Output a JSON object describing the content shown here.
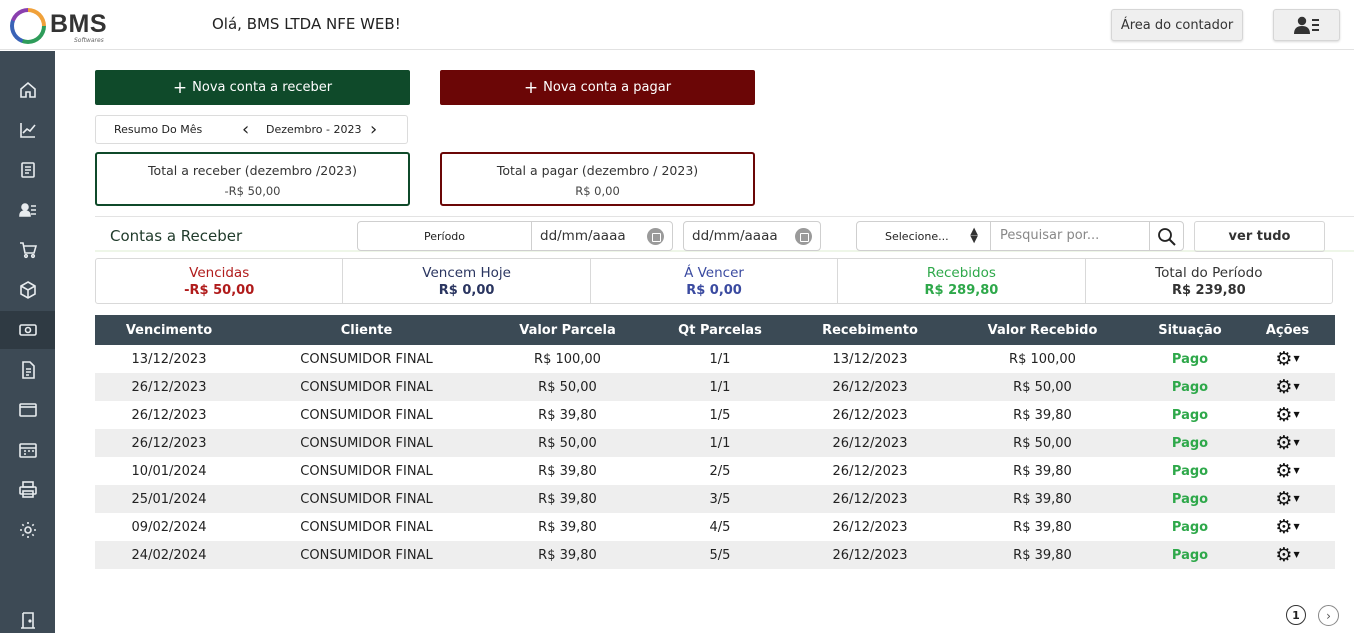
{
  "header": {
    "logo_text": "BMS",
    "logo_sub": "Softwares",
    "greeting": "Olá, BMS LTDA NFE WEB!",
    "contador_label": "Área do contador"
  },
  "sidebar": {
    "items": [
      {
        "icon": "home-icon"
      },
      {
        "icon": "chart-line-icon"
      },
      {
        "icon": "document-icon"
      },
      {
        "icon": "user-list-icon"
      },
      {
        "icon": "cart-icon"
      },
      {
        "icon": "box-icon"
      },
      {
        "icon": "money-icon",
        "active": true
      },
      {
        "icon": "invoice-icon"
      },
      {
        "icon": "window-icon"
      },
      {
        "icon": "calendar-icon"
      },
      {
        "icon": "printer-icon"
      },
      {
        "icon": "gear-icon"
      },
      {
        "icon": "exit-door-icon"
      }
    ]
  },
  "actions": {
    "receber_label": "Nova conta a receber",
    "pagar_label": "Nova conta a pagar"
  },
  "month_nav": {
    "label": "Resumo Do Mês",
    "current": "Dezembro - 2023"
  },
  "totals": {
    "receber_title": "Total a receber (dezembro /2023)",
    "receber_value": "-R$ 50,00",
    "pagar_title": "Total a pagar (dezembro / 2023)",
    "pagar_value": "R$ 0,00"
  },
  "filters": {
    "section_title": "Contas a Receber",
    "periodo_label": "Período",
    "date_from": "dd/mm/aaaa",
    "date_to": "dd/mm/aaaa",
    "select_value": "Selecione...",
    "search_placeholder": "Pesquisar por...",
    "ver_tudo_label": "ver tudo"
  },
  "summary": [
    {
      "label": "Vencidas",
      "value": "-R$ 50,00",
      "label_color": "#b01b1b",
      "value_color": "#b01b1b"
    },
    {
      "label": "Vencem Hoje",
      "value": "R$ 0,00",
      "label_color": "#2a3560",
      "value_color": "#2a3560"
    },
    {
      "label": "Á Vencer",
      "value": "R$ 0,00",
      "label_color": "#3a4aa0",
      "value_color": "#3a4aa0"
    },
    {
      "label": "Recebidos",
      "value": "R$ 289,80",
      "label_color": "#2ea84a",
      "value_color": "#2ea84a"
    },
    {
      "label": "Total do Período",
      "value": "R$ 239,80",
      "label_color": "#333333",
      "value_color": "#333333"
    }
  ],
  "table": {
    "columns": [
      "Vencimento",
      "Cliente",
      "Valor Parcela",
      "Qt Parcelas",
      "Recebimento",
      "Valor Recebido",
      "Situação",
      "Ações"
    ],
    "rows": [
      [
        "13/12/2023",
        "CONSUMIDOR FINAL",
        "R$ 100,00",
        "1/1",
        "13/12/2023",
        "R$ 100,00",
        "Pago"
      ],
      [
        "26/12/2023",
        "CONSUMIDOR FINAL",
        "R$ 50,00",
        "1/1",
        "26/12/2023",
        "R$ 50,00",
        "Pago"
      ],
      [
        "26/12/2023",
        "CONSUMIDOR FINAL",
        "R$ 39,80",
        "1/5",
        "26/12/2023",
        "R$ 39,80",
        "Pago"
      ],
      [
        "26/12/2023",
        "CONSUMIDOR FINAL",
        "R$ 50,00",
        "1/1",
        "26/12/2023",
        "R$ 50,00",
        "Pago"
      ],
      [
        "10/01/2024",
        "CONSUMIDOR FINAL",
        "R$ 39,80",
        "2/5",
        "26/12/2023",
        "R$ 39,80",
        "Pago"
      ],
      [
        "25/01/2024",
        "CONSUMIDOR FINAL",
        "R$ 39,80",
        "3/5",
        "26/12/2023",
        "R$ 39,80",
        "Pago"
      ],
      [
        "09/02/2024",
        "CONSUMIDOR FINAL",
        "R$ 39,80",
        "4/5",
        "26/12/2023",
        "R$ 39,80",
        "Pago"
      ],
      [
        "24/02/2024",
        "CONSUMIDOR FINAL",
        "R$ 39,80",
        "5/5",
        "26/12/2023",
        "R$ 39,80",
        "Pago"
      ]
    ]
  },
  "pagination": {
    "current_page": "1"
  }
}
